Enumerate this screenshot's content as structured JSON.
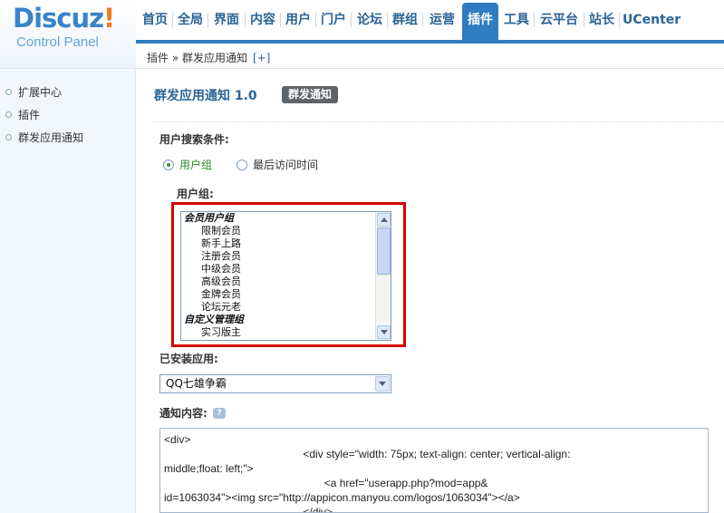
{
  "logo": {
    "main": "Discuz",
    "excl": "!",
    "sub": "Control Panel"
  },
  "nav": [
    "首页",
    "全局",
    "界面",
    "内容",
    "用户",
    "门户",
    "论坛",
    "群组",
    "运营",
    "插件",
    "工具",
    "云平台",
    "站长",
    "UCenter"
  ],
  "nav_active": "插件",
  "breadcrumb": {
    "path": "插件 » 群发应用通知",
    "plus": "[+]"
  },
  "sidebar": {
    "items": [
      "扩展中心",
      "插件",
      "群发应用通知"
    ]
  },
  "page": {
    "title": "群发应用通知 1.0",
    "tag": "群发通知",
    "search_label": "用户搜索条件:",
    "radio_group": "用户组",
    "radio_last_visit": "最后访问时间",
    "usergroup_label": "用户组:",
    "listbox": [
      {
        "type": "group",
        "text": "会员用户组"
      },
      {
        "type": "opt",
        "text": "限制会员"
      },
      {
        "type": "opt",
        "text": "新手上路"
      },
      {
        "type": "opt",
        "text": "注册会员"
      },
      {
        "type": "opt",
        "text": "中级会员"
      },
      {
        "type": "opt",
        "text": "高级会员"
      },
      {
        "type": "opt",
        "text": "金牌会员"
      },
      {
        "type": "opt",
        "text": "论坛元老"
      },
      {
        "type": "group",
        "text": "自定义管理组"
      },
      {
        "type": "opt",
        "text": "实习版主"
      }
    ],
    "app_label": "已安装应用:",
    "app_selected": "QQ七雄争霸",
    "content_label": "通知内容:",
    "help_icon": "?",
    "content_lines": [
      "<div>",
      "                                              <div style=\"width: 75px; text-align: center; vertical-align:",
      "middle;float: left;\">",
      "                                                     <a href=\"userapp.php?mod=app&",
      "id=1063034\"><img src=\"http://appicon.manyou.com/logos/1063034\"></a>",
      "                                              </div>"
    ]
  },
  "colors": {
    "accent": "#2f7cc0",
    "highlight_box": "#d40000",
    "logo_orange": "#f37b1d"
  }
}
